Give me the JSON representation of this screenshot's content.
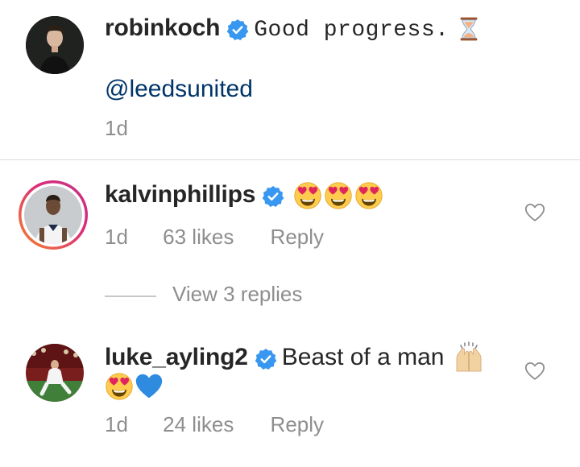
{
  "comments": [
    {
      "username": "robinkoch",
      "text": "Good progress.",
      "mention": "@leedsunited",
      "time": "1d",
      "icons": [
        "verified-badge-icon",
        "hourglass-icon"
      ]
    },
    {
      "username": "kalvinphillips",
      "time": "1d",
      "likes": "63 likes",
      "reply": "Reply",
      "view_replies": "View 3 replies",
      "icons": [
        "verified-badge-icon",
        "heart-eyes-emoji",
        "heart-eyes-emoji",
        "heart-eyes-emoji",
        "heart-outline-icon"
      ]
    },
    {
      "username": "luke_ayling2",
      "text": "Beast of a man",
      "time": "1d",
      "likes": "24 likes",
      "reply": "Reply",
      "icons": [
        "verified-badge-icon",
        "raising-hands-emoji",
        "heart-eyes-emoji",
        "blue-heart-emoji",
        "heart-outline-icon"
      ]
    }
  ],
  "colors": {
    "verified": "#3897f0",
    "mention": "#003569",
    "meta": "#8e8e8e",
    "story_ring_start": "#f58529",
    "story_ring_end": "#dd2a7b"
  }
}
